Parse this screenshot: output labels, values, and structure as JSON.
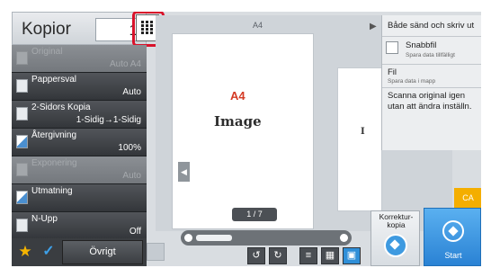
{
  "header": {
    "title": "Kopior",
    "copies": "1",
    "keypad_icon": "keypad-icon"
  },
  "functions": [
    {
      "label": "Original",
      "value": "Auto  A4",
      "enabled": false
    },
    {
      "label": "Pappersval",
      "value": "Auto",
      "enabled": true
    },
    {
      "label": "2-Sidors Kopia",
      "value": "1-Sidig→1-Sidig",
      "enabled": true
    },
    {
      "label": "Återgivning",
      "value": "100%",
      "enabled": true
    },
    {
      "label": "Exponering",
      "value": "Auto",
      "enabled": false
    },
    {
      "label": "Utmatning",
      "value": "",
      "enabled": true
    },
    {
      "label": "N-Upp",
      "value": "Off",
      "enabled": true
    }
  ],
  "bottom": {
    "favorites_icon": "star-icon",
    "check_icon": "check-icon",
    "ovrigt": "Övrigt"
  },
  "preview": {
    "paper_size": "A4",
    "page_label": "A4",
    "page_image_text": "Image",
    "second_page_text": "I",
    "page_counter": "1 / 7"
  },
  "menu": {
    "header": "Både sänd och skriv ut",
    "items": [
      {
        "title": "Snabbfil",
        "sub": "Spara data tillfälligt"
      },
      {
        "title": "Fil",
        "sub": "Spara data i mapp"
      },
      {
        "title": "Scanna original igen utan att ändra inställn.",
        "sub": ""
      }
    ]
  },
  "actions": {
    "ca": "CA",
    "proof": "Korrektur-kopia",
    "start": "Start"
  },
  "colors": {
    "accent": "#2f8fd8",
    "highlight": "#d9122a",
    "ca": "#f4ae00",
    "red_text": "#d43a24"
  }
}
